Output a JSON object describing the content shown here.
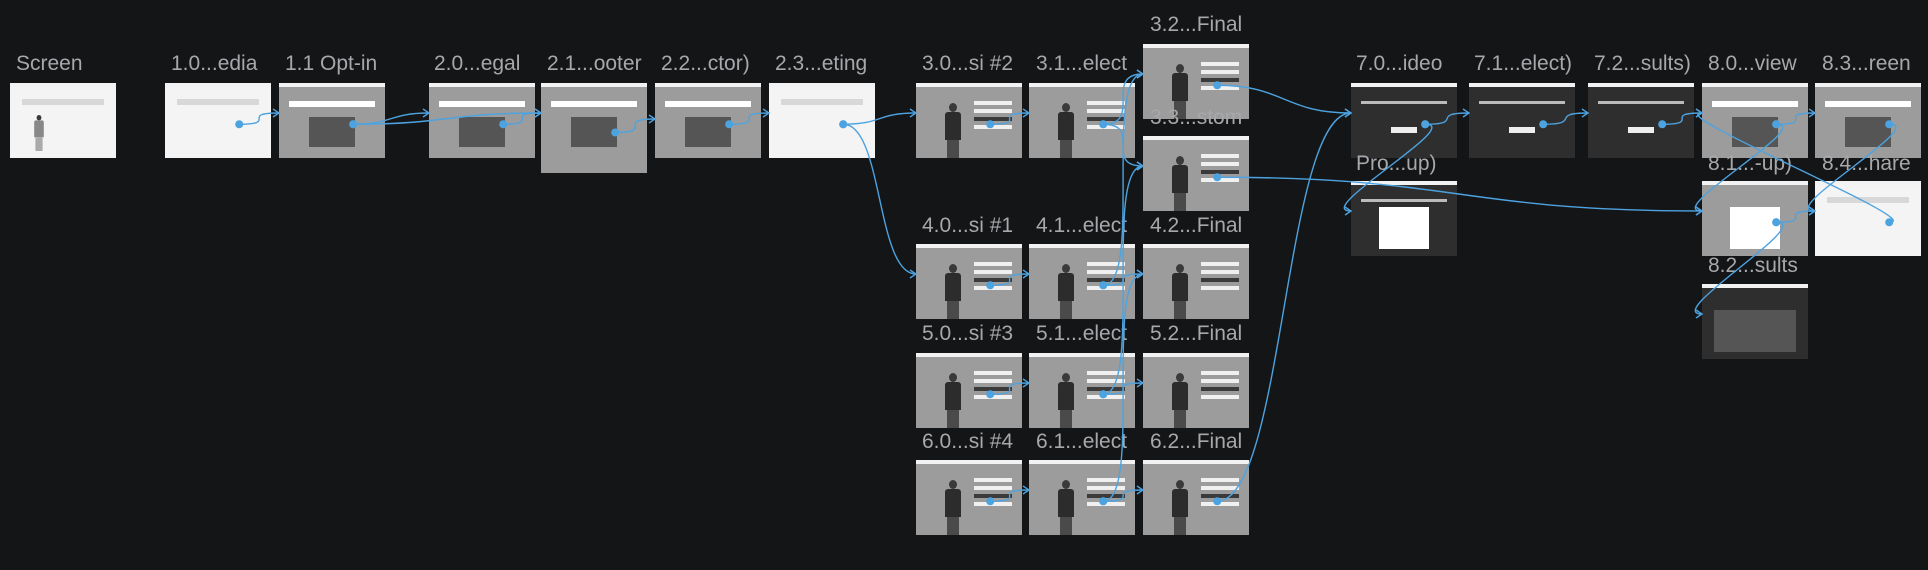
{
  "canvas": {
    "background": "#141517",
    "wire_color": "#4da3e0"
  },
  "screens": [
    {
      "id": "screen",
      "label": "Screen",
      "kind": "light-doc"
    },
    {
      "id": "s1_0",
      "label": "1.0...edia",
      "kind": "light-list"
    },
    {
      "id": "s1_1",
      "label": "1.1 Opt-in",
      "kind": "video-grey"
    },
    {
      "id": "s2_0",
      "label": "2.0...egal",
      "kind": "video-grey"
    },
    {
      "id": "s2_1",
      "label": "2.1...ooter",
      "kind": "video-grey"
    },
    {
      "id": "s2_2",
      "label": "2.2...ctor)",
      "kind": "video-grey"
    },
    {
      "id": "s2_3",
      "label": "2.3...eting",
      "kind": "form-light"
    },
    {
      "id": "s3_0",
      "label": "3.0...si #2",
      "kind": "player"
    },
    {
      "id": "s3_1",
      "label": "3.1...elect",
      "kind": "player"
    },
    {
      "id": "s3_2",
      "label": "3.2...Final",
      "kind": "player"
    },
    {
      "id": "s3_3",
      "label": "3.3...stom",
      "kind": "player"
    },
    {
      "id": "s4_0",
      "label": "4.0...si #1",
      "kind": "player"
    },
    {
      "id": "s4_1",
      "label": "4.1...elect",
      "kind": "player"
    },
    {
      "id": "s4_2",
      "label": "4.2...Final",
      "kind": "player"
    },
    {
      "id": "s5_0",
      "label": "5.0...si #3",
      "kind": "player"
    },
    {
      "id": "s5_1",
      "label": "5.1...elect",
      "kind": "player"
    },
    {
      "id": "s5_2",
      "label": "5.2...Final",
      "kind": "player"
    },
    {
      "id": "s6_0",
      "label": "6.0...si #4",
      "kind": "player"
    },
    {
      "id": "s6_1",
      "label": "6.1...elect",
      "kind": "player"
    },
    {
      "id": "s6_2",
      "label": "6.2...Final",
      "kind": "player"
    },
    {
      "id": "s7_0",
      "label": "7.0...ideo",
      "kind": "dark"
    },
    {
      "id": "s7_1",
      "label": "7.1...elect)",
      "kind": "dark"
    },
    {
      "id": "s7_2",
      "label": "7.2...sults)",
      "kind": "dark"
    },
    {
      "id": "spro",
      "label": "Pro...up)",
      "kind": "dark-modal"
    },
    {
      "id": "s8_0",
      "label": "8.0...view",
      "kind": "video-grey"
    },
    {
      "id": "s8_1",
      "label": "8.1...-up)",
      "kind": "modal-grey"
    },
    {
      "id": "s8_2",
      "label": "8.2...sults",
      "kind": "dark-panel"
    },
    {
      "id": "s8_3",
      "label": "8.3...reen",
      "kind": "photo"
    },
    {
      "id": "s8_4",
      "label": "8.4...hare",
      "kind": "light-share"
    }
  ],
  "links": [
    [
      "s1_0",
      "s1_1"
    ],
    [
      "s1_1",
      "s2_0"
    ],
    [
      "s1_1",
      "s2_1"
    ],
    [
      "s2_0",
      "s2_1"
    ],
    [
      "s2_1",
      "s2_2"
    ],
    [
      "s2_2",
      "s2_3"
    ],
    [
      "s2_3",
      "s3_0"
    ],
    [
      "s2_3",
      "s4_0"
    ],
    [
      "s3_0",
      "s3_1"
    ],
    [
      "s3_1",
      "s3_2"
    ],
    [
      "s3_1",
      "s3_3"
    ],
    [
      "s4_0",
      "s4_1"
    ],
    [
      "s4_1",
      "s4_2"
    ],
    [
      "s4_1",
      "s3_2"
    ],
    [
      "s5_0",
      "s5_1"
    ],
    [
      "s5_1",
      "s5_2"
    ],
    [
      "s5_1",
      "s3_3"
    ],
    [
      "s6_0",
      "s6_1"
    ],
    [
      "s6_1",
      "s6_2"
    ],
    [
      "s6_1",
      "s4_2"
    ],
    [
      "s6_2",
      "s7_0"
    ],
    [
      "s3_2",
      "s7_0"
    ],
    [
      "s3_3",
      "s8_1"
    ],
    [
      "s7_0",
      "s7_1"
    ],
    [
      "s7_0",
      "spro"
    ],
    [
      "s7_1",
      "s7_2"
    ],
    [
      "s7_2",
      "s8_0"
    ],
    [
      "s8_0",
      "s8_1"
    ],
    [
      "s8_0",
      "s8_3"
    ],
    [
      "s8_1",
      "s8_2"
    ],
    [
      "s8_1",
      "s8_4"
    ],
    [
      "s8_3",
      "s8_4"
    ],
    [
      "s8_4",
      "s8_0"
    ]
  ]
}
